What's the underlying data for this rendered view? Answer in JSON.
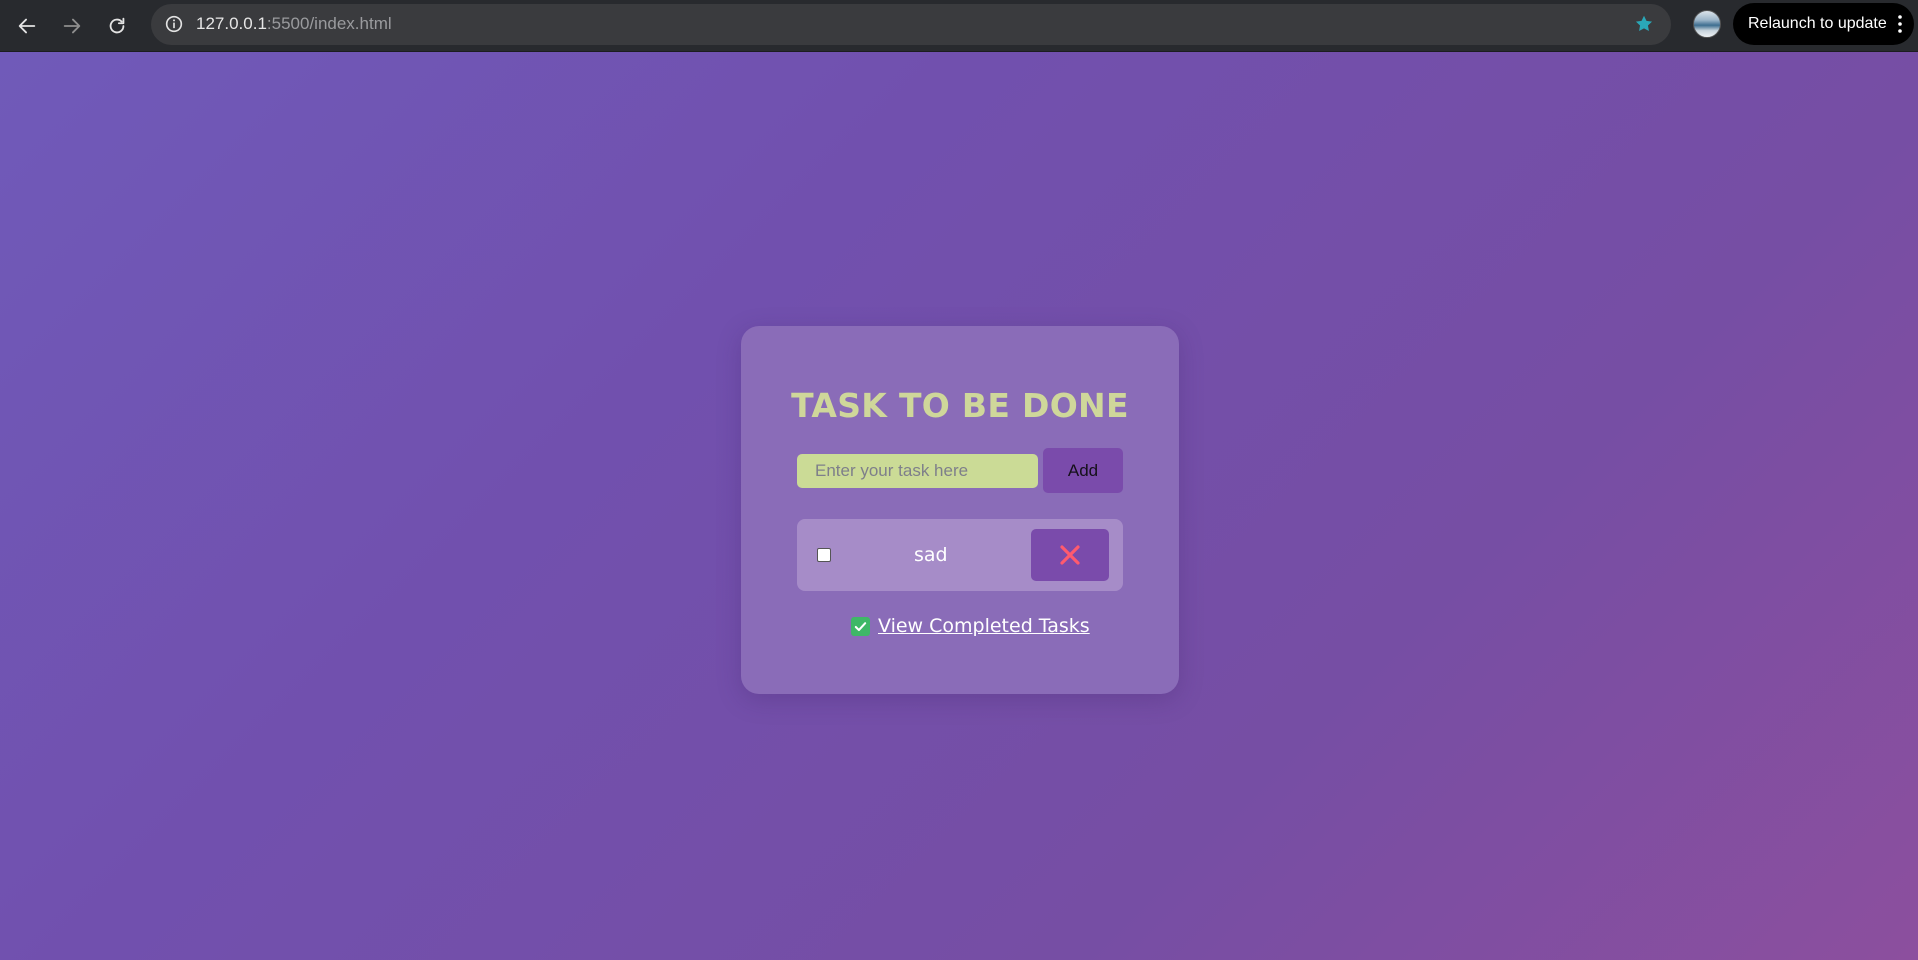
{
  "browser": {
    "url_host": "127.0.0.1",
    "url_rest": ":5500/index.html",
    "relaunch_label": "Relaunch to update",
    "star_color": "#2aa8b8"
  },
  "app": {
    "title": "TASK TO BE DONE",
    "input_placeholder": "Enter your task here",
    "input_value": "",
    "add_label": "Add",
    "tasks": [
      {
        "text": "sad",
        "completed": false
      }
    ],
    "completed_link_label": "View Completed Tasks"
  },
  "colors": {
    "title": "#cfd79a",
    "card": "#8a6cb8",
    "task_bg": "#a68cc8",
    "button": "#7a4bab",
    "input_bg": "#cbdb96",
    "delete_x": "#ff5a6e",
    "check_emoji": "#3fb867"
  }
}
